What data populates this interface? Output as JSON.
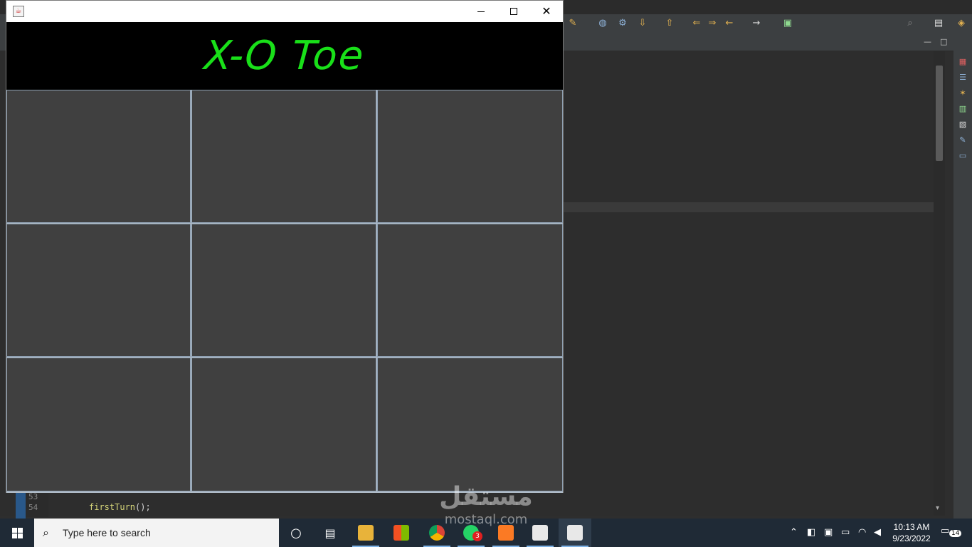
{
  "app": {
    "title": "X-O Toe",
    "title_color": "#19e019",
    "header_background": "#000000",
    "cell_color": "#404040",
    "grid_line_color": "#8fa0b2",
    "board": {
      "rows": 3,
      "columns": 3,
      "cells": [
        "",
        "",
        "",
        "",
        "",
        "",
        "",
        "",
        ""
      ]
    },
    "window_icon": "java-icon",
    "window_buttons": [
      "minimize",
      "maximize",
      "close"
    ]
  },
  "ide": {
    "line_numbers": [
      "53",
      "54"
    ],
    "code_call": "firstTurn",
    "code_suffix": "();"
  },
  "taskbar": {
    "search_placeholder": "Type here to search",
    "apps": [
      {
        "icon": "cortana-icon"
      },
      {
        "icon": "task-view-icon"
      },
      {
        "icon": "file-explorer-icon"
      },
      {
        "icon": "microsoft-store-icon"
      },
      {
        "icon": "chrome-icon"
      },
      {
        "icon": "whatsapp-icon",
        "badge": "3"
      },
      {
        "icon": "xampp-icon"
      },
      {
        "icon": "java-icon"
      },
      {
        "icon": "java-icon"
      }
    ],
    "clock_time": "10:13 AM",
    "clock_date": "9/23/2022",
    "notification_count": "14"
  },
  "watermark": {
    "arabic": "مستقل",
    "latin": "mostaql.com"
  }
}
